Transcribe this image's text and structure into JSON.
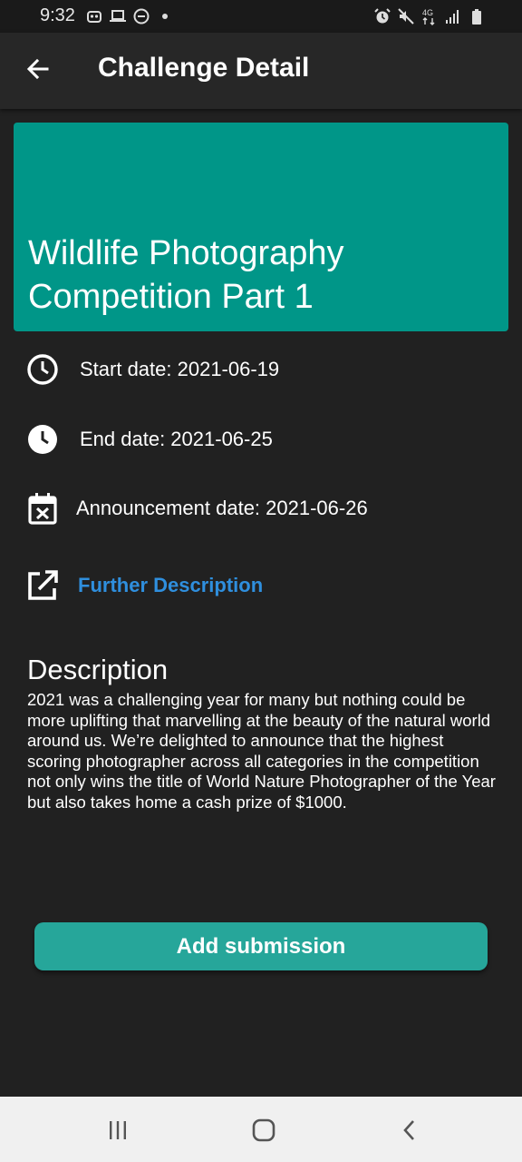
{
  "status_bar": {
    "time": "9:32",
    "left_icons": [
      "robot-icon",
      "laptop-icon",
      "do-not-disturb-icon",
      "dot-icon"
    ],
    "right_icons": [
      "alarm-icon",
      "mute-icon",
      "4g-icon",
      "signal-icon",
      "battery-icon"
    ],
    "network_label": "4G"
  },
  "app_bar": {
    "title": "Challenge Detail"
  },
  "challenge": {
    "title": "Wildlife Photography Competition Part 1",
    "header_color": "#009688",
    "start_date": "Start date: 2021-06-19",
    "end_date": "End date: 2021-06-25",
    "announcement_date": "Announcement date: 2021-06-26",
    "further_description_link": "Further Description",
    "link_color": "#2f8fde",
    "description_heading": "Description",
    "description": "2021 was a challenging year for many but nothing could be more uplifting that marvelling at the beauty of the natural world around us. We’re delighted to announce that the highest scoring photographer across all categories in the competition not only wins the title of World Nature Photographer of the Year but also takes home a cash prize of $1000."
  },
  "actions": {
    "add_submission": "Add submission",
    "button_color": "#26a69a"
  },
  "nav_bar": {
    "buttons": [
      "recent-apps-icon",
      "home-icon",
      "back-icon"
    ]
  }
}
